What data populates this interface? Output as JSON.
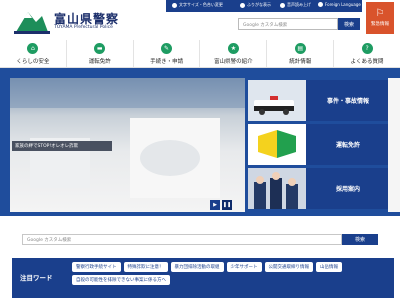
{
  "header": {
    "title": "富山県警察",
    "subtitle": "TOYAMA Prefectural Police",
    "util_links": [
      "文字サイズ・色合い変更",
      "ふりがな表示",
      "音声読み上げ",
      "Foreign Language"
    ],
    "search_placeholder": "Google カスタム検索",
    "search_button": "検索",
    "emergency_label": "緊急情報"
  },
  "nav": {
    "items": [
      {
        "label": "くらしの安全",
        "icon": "house-icon"
      },
      {
        "label": "運転免許",
        "icon": "car-icon"
      },
      {
        "label": "手続き・申請",
        "icon": "pen-icon"
      },
      {
        "label": "富山県警の紹介",
        "icon": "badge-icon"
      },
      {
        "label": "統計情報",
        "icon": "chart-icon"
      },
      {
        "label": "よくある質問",
        "icon": "question-icon"
      }
    ]
  },
  "hero": {
    "caption": "家族の絆でSTOP!オレオレ詐欺"
  },
  "side_cards": [
    {
      "label": "事件・事故情報"
    },
    {
      "label": "運転免許"
    },
    {
      "label": "採用案内"
    }
  ],
  "search_mid": {
    "placeholder": "Google カスタム検索",
    "button": "検索"
  },
  "attention": {
    "label": "注目ワード",
    "links": [
      "警察行政手続サイト",
      "特殊詐欺に注意！",
      "暴力団排除活動の取組",
      "少年サポート",
      "公開交通取締り情報",
      "山岳情報",
      "自殺の可能性を排除できない事案に係る方へ"
    ]
  },
  "colors": {
    "primary": "#1a3f8c",
    "accent_green": "#1e9c62",
    "emergency": "#d9532b"
  }
}
